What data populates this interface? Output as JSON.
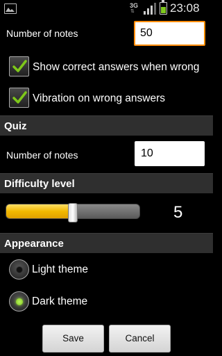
{
  "status_bar": {
    "network": "3G",
    "time": "23:08",
    "icons": [
      "gallery-icon",
      "signal-icon",
      "battery-icon"
    ]
  },
  "settings": {
    "number_of_notes_label": "Number of notes",
    "number_of_notes_value": "50",
    "show_correct_answers": {
      "label": "Show correct answers when wrong",
      "checked": true
    },
    "vibration": {
      "label": "Vibration on wrong answers",
      "checked": true
    }
  },
  "quiz": {
    "header": "Quiz",
    "number_of_notes_label": "Number of notes",
    "number_of_notes_value": "10"
  },
  "difficulty": {
    "header": "Difficulty level",
    "value": "5",
    "slider_fraction": 0.5
  },
  "appearance": {
    "header": "Appearance",
    "options": [
      {
        "label": "Light theme",
        "selected": false
      },
      {
        "label": "Dark theme",
        "selected": true
      }
    ]
  },
  "buttons": {
    "save": "Save",
    "cancel": "Cancel"
  },
  "colors": {
    "focus_border": "#ff8c00",
    "check_green": "#7ec81a",
    "slider_fill": "#f2b800",
    "header_bg": "#2f2f2f"
  }
}
